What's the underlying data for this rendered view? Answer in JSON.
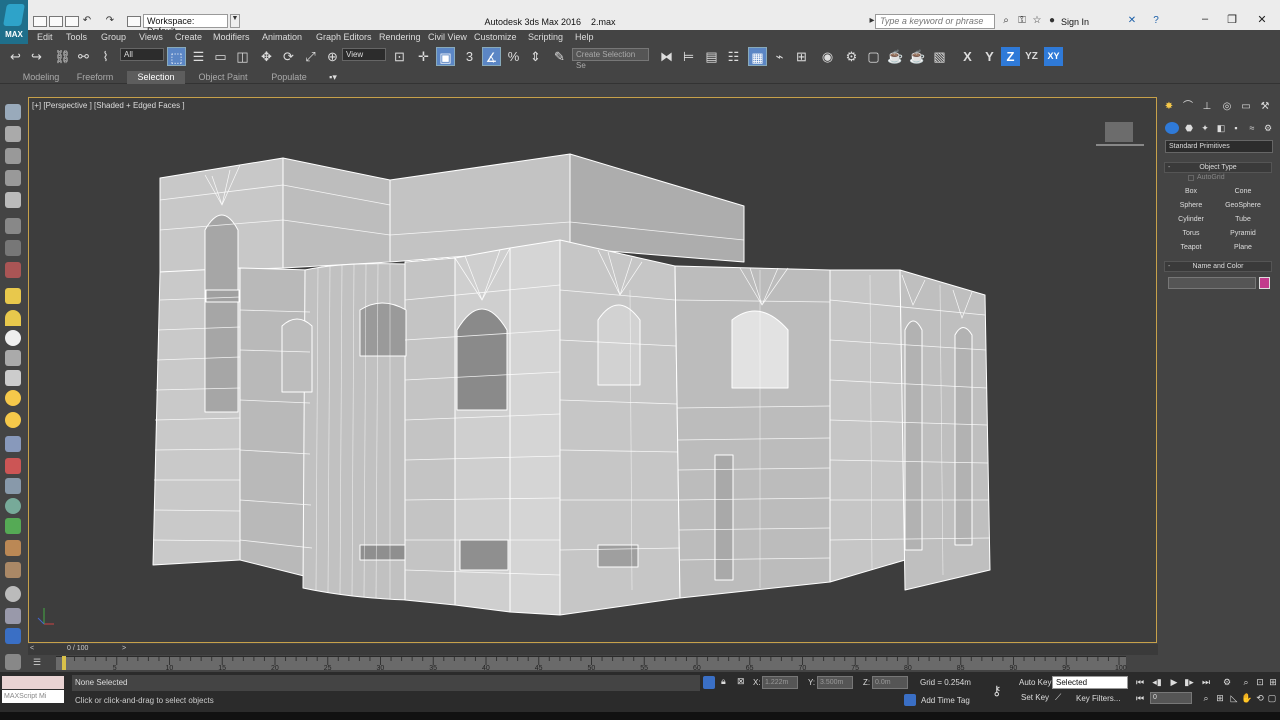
{
  "window": {
    "app_title": "Autodesk 3ds Max 2016",
    "file_name": "2.max",
    "workspace": "Workspace: Default",
    "logo_text": "MAX",
    "search_placeholder": "Type a keyword or phrase",
    "sign_in": "Sign In"
  },
  "menu": [
    "Edit",
    "Tools",
    "Group",
    "Views",
    "Create",
    "Modifiers",
    "Animation",
    "Graph Editors",
    "Rendering",
    "Civil View",
    "Customize",
    "Scripting",
    "Help"
  ],
  "toolbar": {
    "filter": "All",
    "ref_coord": "View",
    "named_selection_placeholder": "Create Selection Se",
    "axes": [
      "X",
      "Y",
      "Z",
      "YZ",
      "XY"
    ],
    "snap_label": "3"
  },
  "ribbon_tabs": [
    "Modeling",
    "Freeform",
    "Selection",
    "Object Paint",
    "Populate"
  ],
  "ribbon_active": "Selection",
  "viewport": {
    "label": "[+] [Perspective ] [Shaded + Edged Faces ]"
  },
  "command_panel": {
    "category": "Standard Primitives",
    "object_type_title": "Object Type",
    "autogrid": "AutoGrid",
    "buttons": [
      "Box",
      "Cone",
      "Sphere",
      "GeoSphere",
      "Cylinder",
      "Tube",
      "Torus",
      "Pyramid",
      "Teapot",
      "Plane"
    ],
    "name_color_title": "Name and Color",
    "object_color": "#c23b8c"
  },
  "timeline": {
    "frame_counter": "0 / 100",
    "ticks": [
      "5",
      "10",
      "15",
      "20",
      "25",
      "30",
      "35",
      "40",
      "45",
      "50",
      "55",
      "60",
      "65",
      "70",
      "75",
      "80",
      "85",
      "90",
      "95",
      "100"
    ],
    "current_frame": 0,
    "total_frames": 100
  },
  "status": {
    "maxscript": "MAXScript Mi",
    "selection": "None Selected",
    "prompt": "Click or click-and-drag to select objects",
    "x_label": "X:",
    "x_value": "1.222m",
    "y_label": "Y:",
    "y_value": "3.500m",
    "z_label": "Z:",
    "z_value": "0.0m",
    "grid": "Grid = 0.254m",
    "add_time_tag": "Add Time Tag",
    "auto_key": "Auto Key",
    "set_key": "Set Key",
    "key_mode": "Selected",
    "key_filters": "Key Filters...",
    "frame": "0"
  },
  "colors": {
    "viewport_bg": "#3d3d3d",
    "viewport_border": "#c7a14a",
    "accent_blue": "#2f7ad8",
    "ui_dark": "#444444"
  }
}
